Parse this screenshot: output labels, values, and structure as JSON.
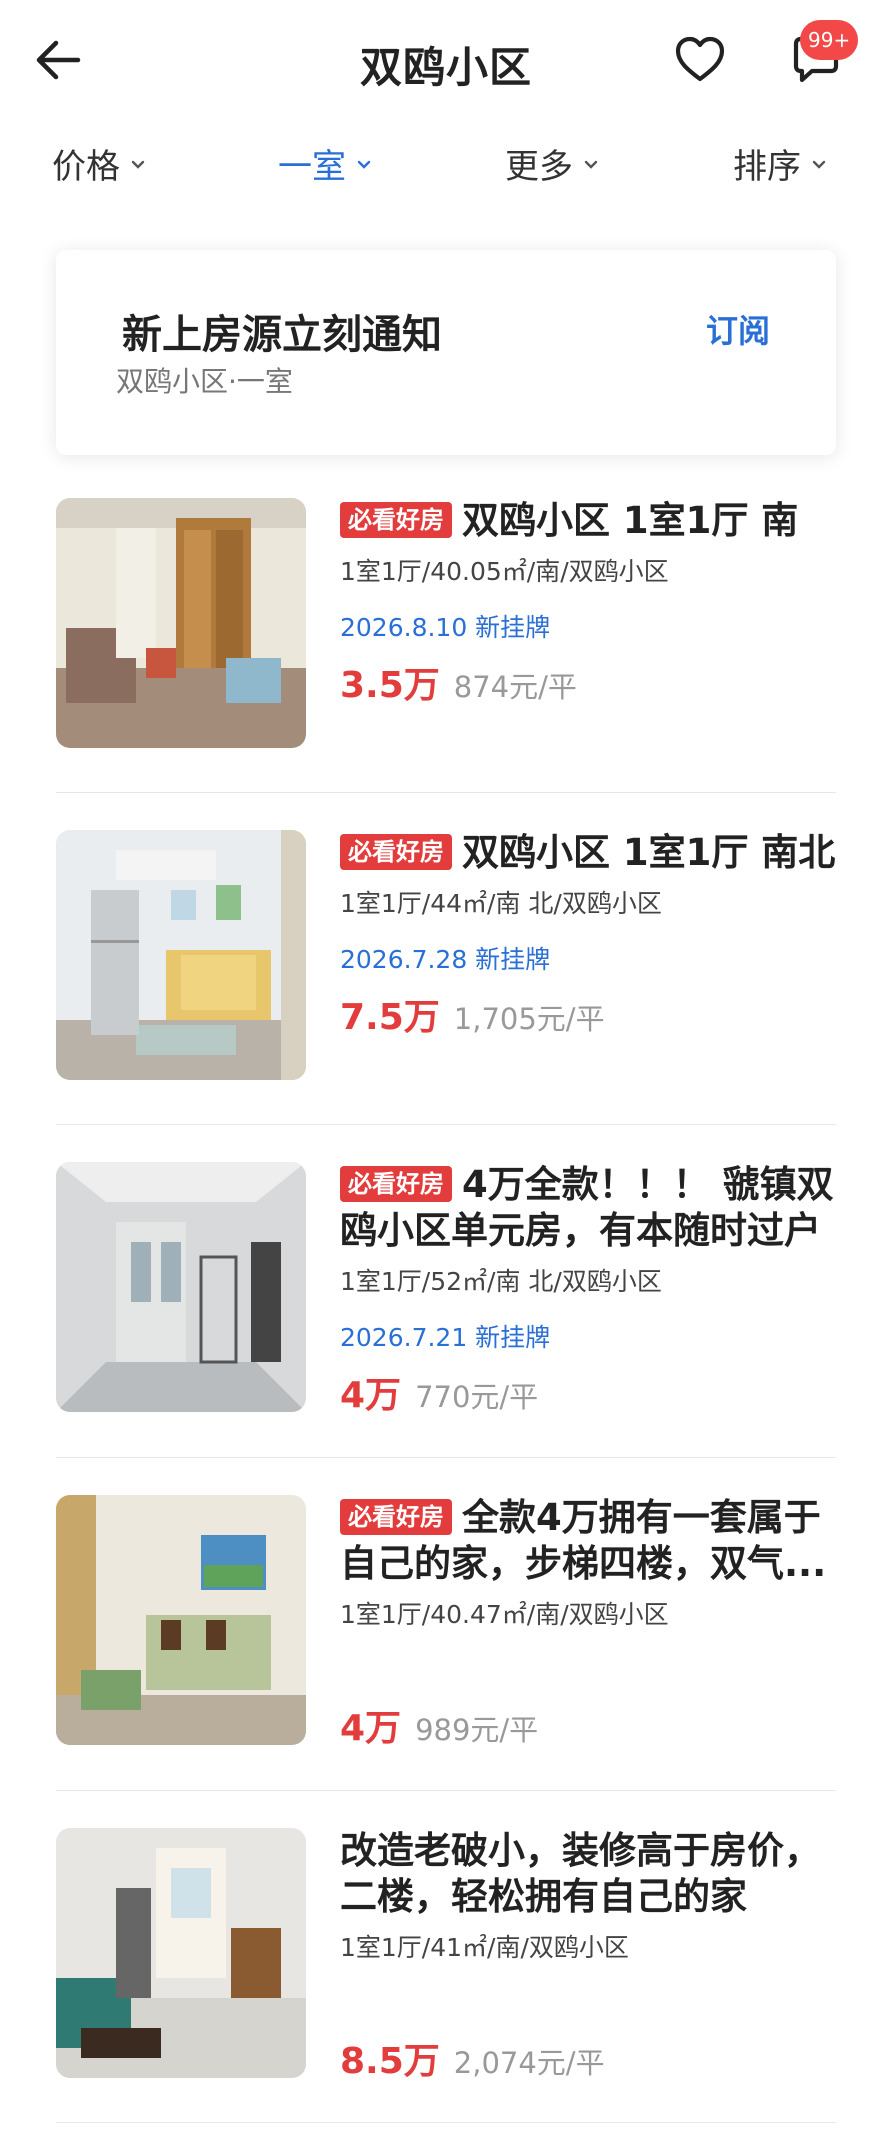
{
  "header": {
    "title": "双鸥小区",
    "badge": "99+",
    "back_icon": "back-arrow-icon",
    "favorite_icon": "heart-icon",
    "message_icon": "chat-bubble-icon"
  },
  "filters": [
    {
      "label": "价格",
      "active": false
    },
    {
      "label": "一室",
      "active": true
    },
    {
      "label": "更多",
      "active": false
    },
    {
      "label": "排序",
      "active": false
    }
  ],
  "subscribe": {
    "title": "新上房源立刻通知",
    "subtitle": "双鸥小区·一室",
    "button": "订阅"
  },
  "listings": [
    {
      "tag": "必看好房",
      "title": "双鸥小区 1室1厅 南",
      "meta": "1室1厅/40.05㎡/南/双鸥小区",
      "date": "2026.8.10 新挂牌",
      "price": "3.5万",
      "unit_price": "874元/平"
    },
    {
      "tag": "必看好房",
      "title": "双鸥小区 1室1厅 南北",
      "meta": "1室1厅/44㎡/南 北/双鸥小区",
      "date": "2026.7.28 新挂牌",
      "price": "7.5万",
      "unit_price": "1,705元/平"
    },
    {
      "tag": "必看好房",
      "title": "4万全款！！！ 虢镇双鸥小区单元房，有本随时过户",
      "meta": "1室1厅/52㎡/南 北/双鸥小区",
      "date": "2026.7.21 新挂牌",
      "price": "4万",
      "unit_price": "770元/平"
    },
    {
      "tag": "必看好房",
      "title": "全款4万拥有一套属于自己的家，步梯四楼，双气...",
      "meta": "1室1厅/40.47㎡/南/双鸥小区",
      "date": "",
      "price": "4万",
      "unit_price": "989元/平"
    },
    {
      "tag": "",
      "title": "改造老破小，装修高于房价，二楼，轻松拥有自己的家",
      "meta": "1室1厅/41㎡/南/双鸥小区",
      "date": "",
      "price": "8.5万",
      "unit_price": "2,074元/平"
    }
  ],
  "colors": {
    "accent": "#2a6fd6",
    "price": "#e23c3c",
    "tag": "#e23c3c",
    "badge": "#f24848"
  }
}
